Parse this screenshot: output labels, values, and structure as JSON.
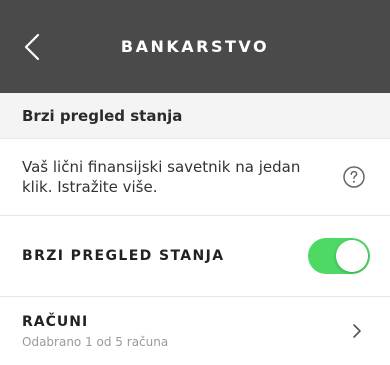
{
  "header": {
    "title": "BANKARSTVO",
    "back_icon": "chevron-left-icon",
    "background": "#4a4a4a"
  },
  "section": {
    "title": "Brzi pregled stanja"
  },
  "info": {
    "text": "Vaš lični finansijski savetnik na jedan klik. Istražite više.",
    "icon": "question-circle-icon"
  },
  "toggle_row": {
    "label": "BRZI PREGLED STANJA",
    "state": "on",
    "accent": "#4cd964"
  },
  "accounts": {
    "title": "RAČUNI",
    "subtitle": "Odabrano 1 od 5 računa",
    "icon": "chevron-right-icon"
  }
}
